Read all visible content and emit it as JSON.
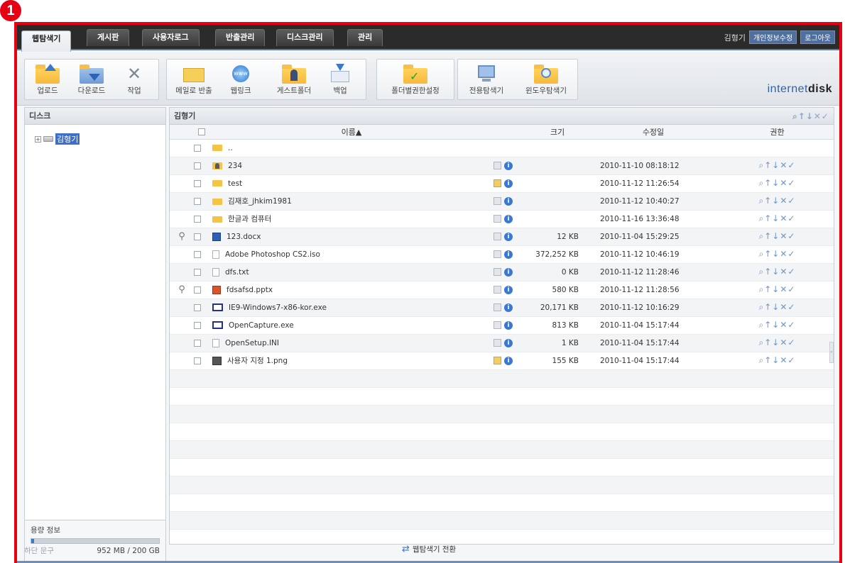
{
  "annotation_badge": "1",
  "tabs": [
    "웹탐색기",
    "게시판",
    "사용자로그",
    "반출관리",
    "디스크관리",
    "관리"
  ],
  "active_tab": 0,
  "user": {
    "name": "김형기",
    "profile_btn": "개인정보수정",
    "logout_btn": "로그아웃"
  },
  "toolbar": {
    "upload": "업로드",
    "download": "다운로드",
    "tools": "작업",
    "email": "메일로 반출",
    "weblink": "웹링크",
    "guest": "게스트폴더",
    "backup": "백업",
    "folder_perm": "폴더별권한설정",
    "dedicated": "전용탐색기",
    "windows": "윈도우탐색기"
  },
  "brand": {
    "a": "internet",
    "b": "disk"
  },
  "left_pane": {
    "title": "디스크",
    "tree_item": "김형기",
    "capacity_title": "용량 정보",
    "capacity_text": "952 MB / 200 GB",
    "capacity_used_fraction": 0.005
  },
  "right_pane": {
    "title": "김형기",
    "head_actions": "⌕↑↓✕✓",
    "columns": {
      "name": "이름▲",
      "size": "크기",
      "modified": "수정일",
      "perm": "권한"
    }
  },
  "files": [
    {
      "name": "..",
      "type": "folder",
      "size": "",
      "date": "",
      "memo": false,
      "info": false,
      "mag": false
    },
    {
      "name": "234",
      "type": "user",
      "size": "",
      "date": "2010-11-10 08:18:12",
      "memo": false,
      "info": true,
      "mag": false
    },
    {
      "name": "test",
      "type": "folder",
      "size": "",
      "date": "2010-11-12 11:26:54",
      "memo": true,
      "info": true,
      "mag": false
    },
    {
      "name": "김재호_jhkim1981",
      "type": "folder",
      "size": "",
      "date": "2010-11-12 10:40:27",
      "memo": false,
      "info": true,
      "mag": false
    },
    {
      "name": "한글과 컴퓨터",
      "type": "folder",
      "size": "",
      "date": "2010-11-16 13:36:48",
      "memo": false,
      "info": true,
      "mag": false
    },
    {
      "name": "123.docx",
      "type": "word",
      "size": "12 KB",
      "date": "2010-11-04 15:29:25",
      "memo": false,
      "info": true,
      "mag": true
    },
    {
      "name": "Adobe Photoshop CS2.iso",
      "type": "doc",
      "size": "372,252 KB",
      "date": "2010-11-12 10:46:19",
      "memo": false,
      "info": true,
      "mag": false
    },
    {
      "name": "dfs.txt",
      "type": "doc",
      "size": "0 KB",
      "date": "2010-11-12 11:28:46",
      "memo": false,
      "info": true,
      "mag": false
    },
    {
      "name": "fdsafsd.pptx",
      "type": "ppt",
      "size": "580 KB",
      "date": "2010-11-12 11:28:56",
      "memo": false,
      "info": true,
      "mag": true
    },
    {
      "name": "IE9-Windows7-x86-kor.exe",
      "type": "exe",
      "size": "20,171 KB",
      "date": "2010-11-12 10:16:29",
      "memo": false,
      "info": true,
      "mag": false
    },
    {
      "name": "OpenCapture.exe",
      "type": "exe",
      "size": "813 KB",
      "date": "2010-11-04 15:17:44",
      "memo": false,
      "info": true,
      "mag": false
    },
    {
      "name": "OpenSetup.INI",
      "type": "doc",
      "size": "1 KB",
      "date": "2010-11-04 15:17:44",
      "memo": false,
      "info": true,
      "mag": false
    },
    {
      "name": "사용자 지정 1.png",
      "type": "img",
      "size": "155 KB",
      "date": "2010-11-04 15:17:44",
      "memo": true,
      "info": true,
      "mag": false
    }
  ],
  "perm_icons": "⌕↑↓✕✓",
  "footer": {
    "left": "하단 문구",
    "switch": "웹탐색기 전환"
  }
}
